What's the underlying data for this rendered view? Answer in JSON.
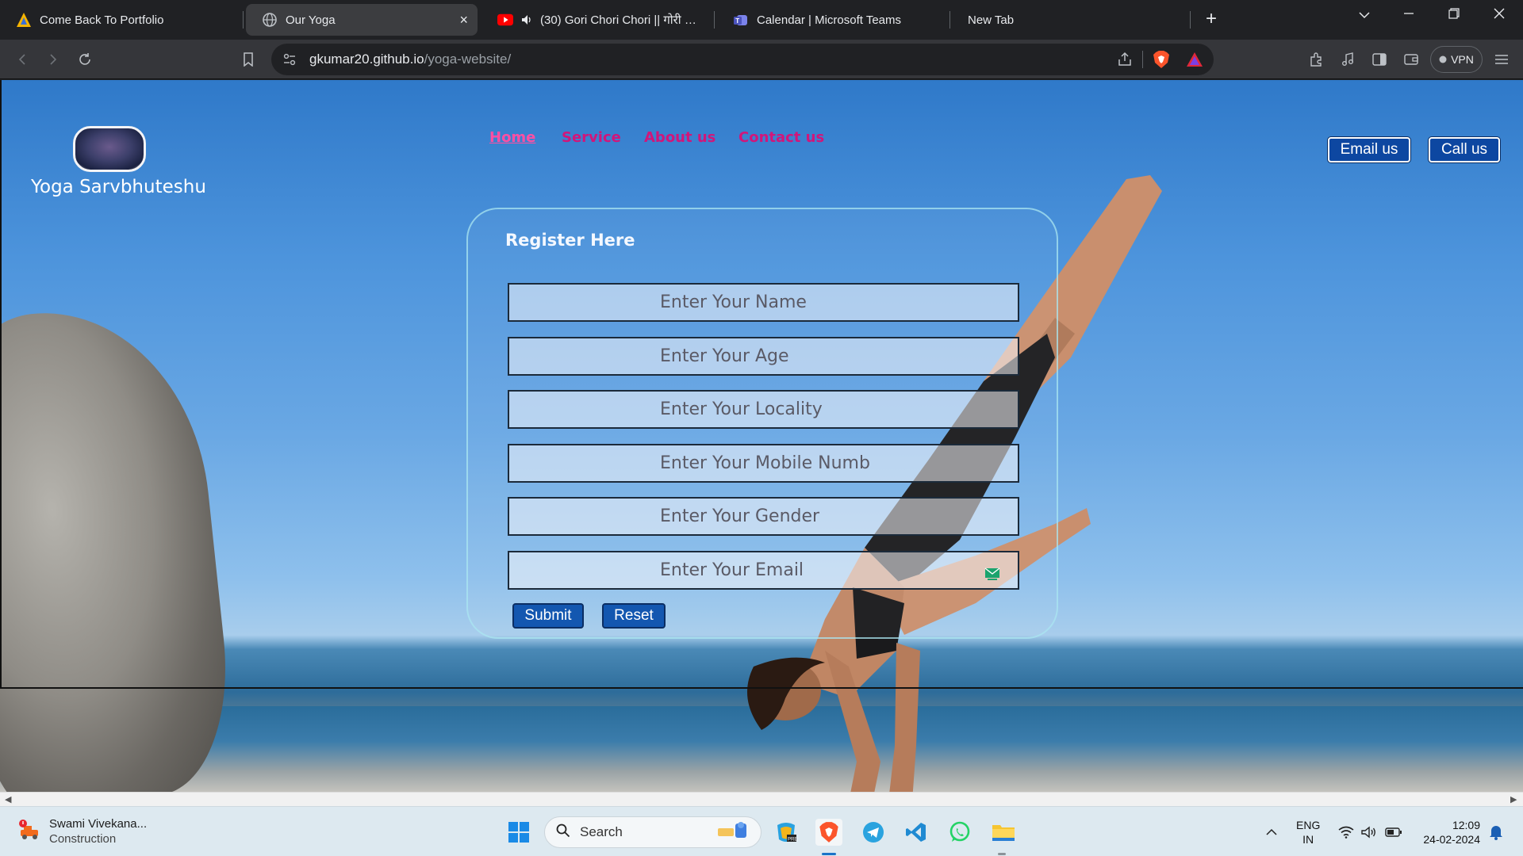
{
  "browser": {
    "tabs": [
      {
        "title": "Come Back To Portfolio",
        "icon": "portfolio-icon",
        "active": false
      },
      {
        "title": "Our Yoga",
        "icon": "globe-icon",
        "active": true
      },
      {
        "title": "(30) Gori Chori Chori || गोरी चोरी च",
        "icon": "youtube-icon",
        "active": false
      },
      {
        "title": "Calendar | Microsoft Teams",
        "icon": "teams-icon",
        "active": false
      },
      {
        "title": "New Tab",
        "icon": "",
        "active": false
      }
    ],
    "new_tab_label": "+",
    "close_tab_label": "×",
    "address": {
      "host": "gkumar20.github.io",
      "path": "/yoga-website/"
    },
    "vpn_label": "VPN"
  },
  "site": {
    "brand": "Yoga Sarvbhuteshu",
    "nav": [
      "Home",
      "Service",
      "About us",
      "Contact us"
    ],
    "header_buttons": {
      "email": "Email us",
      "call": "Call us"
    },
    "form": {
      "title": "Register Here",
      "fields": [
        {
          "placeholder": "Enter Your Name",
          "value": ""
        },
        {
          "placeholder": "Enter Your Age",
          "value": ""
        },
        {
          "placeholder": "Enter Your Locality",
          "value": ""
        },
        {
          "placeholder": "Enter Your Mobile Numb",
          "value": ""
        },
        {
          "placeholder": "Enter Your Gender",
          "value": ""
        },
        {
          "placeholder": "Enter Your Email",
          "value": ""
        }
      ],
      "submit_label": "Submit",
      "reset_label": "Reset"
    }
  },
  "taskbar": {
    "weather": {
      "title": "Swami Vivekana...",
      "subtitle": "Construction"
    },
    "search_label": "Search",
    "language": {
      "line1": "ENG",
      "line2": "IN"
    },
    "clock": {
      "time": "12:09",
      "date": "24-02-2024"
    }
  },
  "colors": {
    "nav_pink": "#d1167a",
    "button_blue": "#1357b0",
    "tab_active": "#3c3d40"
  }
}
